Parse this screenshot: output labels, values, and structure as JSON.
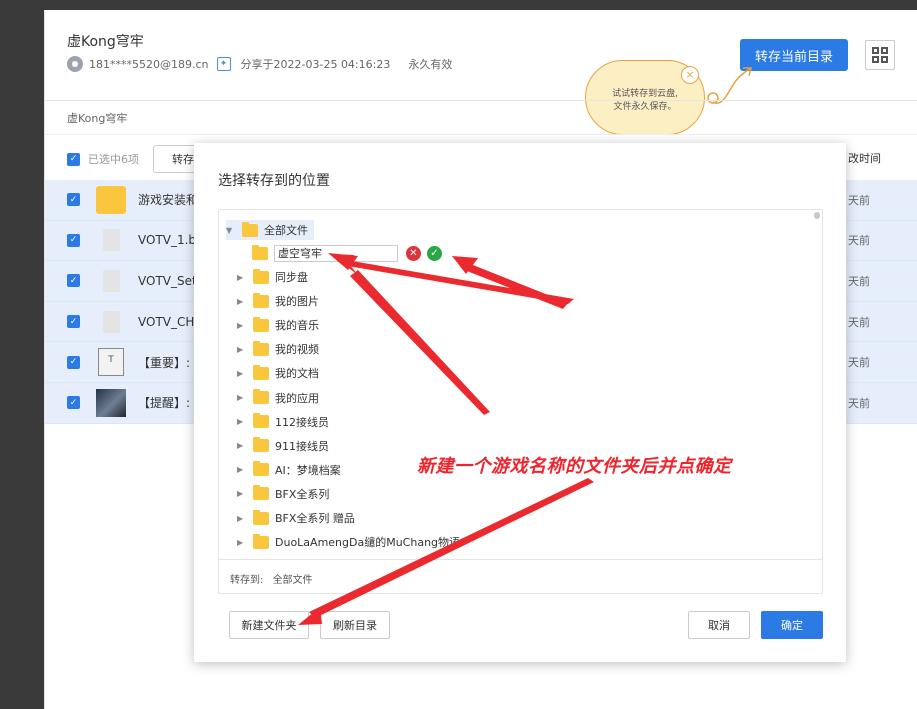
{
  "header": {
    "title": "虚Kong穹牢",
    "user": "181****5520@189.cn",
    "share_time": "分享于2022-03-25 04:16:23",
    "validity": "永久有效",
    "save_button": "转存当前目录"
  },
  "tooltip": {
    "line1": "试试转存到云盘,",
    "line2": "文件永久保存。",
    "close": "×"
  },
  "breadcrumb": "虚Kong穹牢",
  "toolbar": {
    "selected": "已选中6项",
    "save_btn": "转存",
    "col_modified": "改时间"
  },
  "files": [
    {
      "name": "游戏安装和",
      "type": "folder",
      "time": "天前"
    },
    {
      "name": "VOTV_1.bi",
      "type": "file",
      "time": "天前"
    },
    {
      "name": "VOTV_Setu",
      "type": "file",
      "time": "天前"
    },
    {
      "name": "VOTV_CHI",
      "type": "file",
      "time": "天前"
    },
    {
      "name": "【重要】:",
      "type": "txt",
      "time": "天前"
    },
    {
      "name": "【提醒】:",
      "type": "img",
      "time": "天前"
    }
  ],
  "modal": {
    "title": "选择转存到的位置",
    "root": "全部文件",
    "new_folder_value": "虚空穹牢",
    "folders": [
      "同步盘",
      "我的图片",
      "我的音乐",
      "我的视频",
      "我的文档",
      "我的应用",
      "112接线员",
      "911接线员",
      "AI：梦境档案",
      "BFX全系列",
      "BFX全系列 赠品",
      "DuoLaAmengDa缱的MuChang物语"
    ],
    "save_to_label": "转存到:",
    "save_to_value": "全部文件",
    "btn_new_folder": "新建文件夹",
    "btn_refresh": "刷新目录",
    "btn_cancel": "取消",
    "btn_confirm": "确定"
  },
  "annotation": "新建一个游戏名称的文件夹后并点确定",
  "colors": {
    "accent": "#2c7be5",
    "annotation": "#f0242c",
    "folder": "#f9c63d"
  }
}
